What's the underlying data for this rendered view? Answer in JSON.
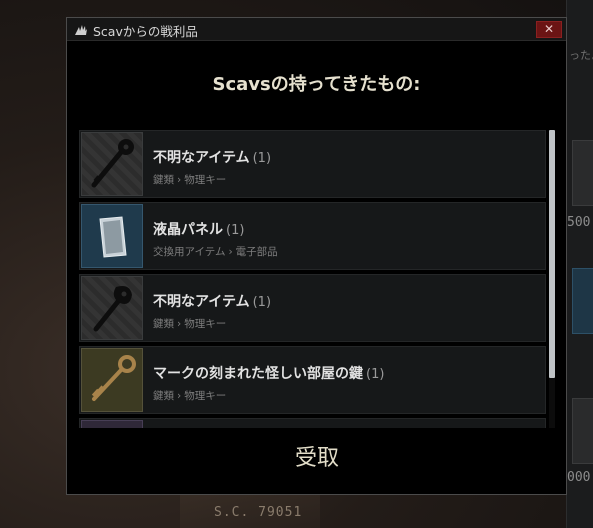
{
  "dialog": {
    "title": "Scavからの戦利品",
    "close_glyph": "✕",
    "heading": "Scavsの持ってきたもの:",
    "accept_label": "受取"
  },
  "items": [
    {
      "name": "不明なアイテム",
      "count": "(1)",
      "category": "鍵類",
      "subcategory": "物理キー",
      "icon": "black-key-icon"
    },
    {
      "name": "液晶パネル",
      "count": "(1)",
      "category": "交換用アイテム",
      "subcategory": "電子部品",
      "icon": "lcd-panel-icon"
    },
    {
      "name": "不明なアイテム",
      "count": "(1)",
      "category": "鍵類",
      "subcategory": "物理キー",
      "icon": "black-key-icon"
    },
    {
      "name": "マークの刻まれた怪しい部屋の鍵",
      "count": "(1)",
      "category": "鍵類",
      "subcategory": "物理キー",
      "icon": "brass-key-icon"
    }
  ],
  "category_separator": "›",
  "background": {
    "paper_text": "S.C.  79051",
    "numbers": [
      "500",
      "000"
    ],
    "hint_text": "ったよ"
  },
  "colors": {
    "close_button": "#6b1414",
    "panel_thumb": "#1f3a4c",
    "brass_thumb": "#3c3a22",
    "heading": "#e6e1cf"
  }
}
